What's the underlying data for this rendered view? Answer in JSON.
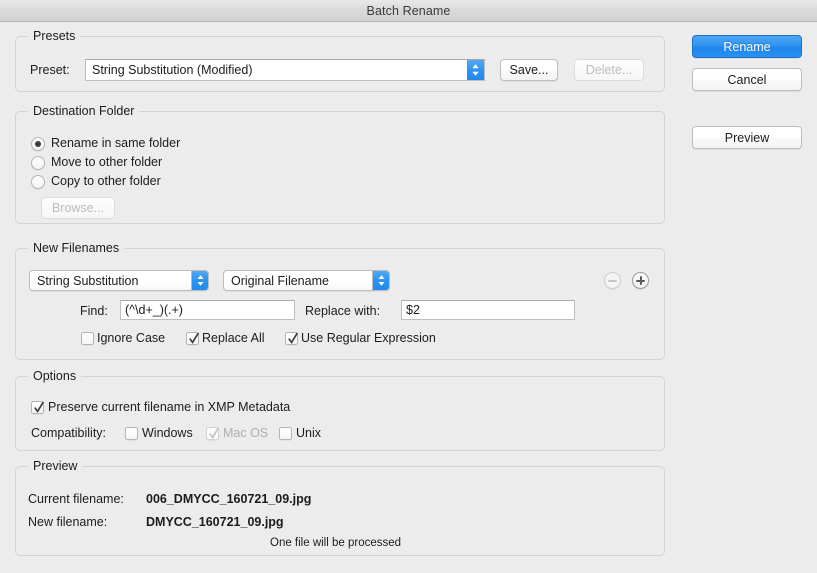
{
  "window": {
    "title": "Batch Rename"
  },
  "presets": {
    "group_label": "Presets",
    "preset_label": "Preset:",
    "preset_value": "String Substitution (Modified)",
    "save_button": "Save...",
    "delete_button": "Delete..."
  },
  "destination": {
    "group_label": "Destination Folder",
    "options": [
      {
        "label": "Rename in same folder",
        "selected": true
      },
      {
        "label": "Move to other folder",
        "selected": false
      },
      {
        "label": "Copy to other folder",
        "selected": false
      }
    ],
    "browse_button": "Browse..."
  },
  "new_filenames": {
    "group_label": "New Filenames",
    "rule_type": "String Substitution",
    "rule_source": "Original Filename",
    "find_label": "Find:",
    "find_value": "(^\\d+_)(.+)",
    "replace_label": "Replace with:",
    "replace_value": "$2",
    "checkboxes": [
      {
        "label": "Ignore Case",
        "checked": false
      },
      {
        "label": "Replace All",
        "checked": true
      },
      {
        "label": "Use Regular Expression",
        "checked": true
      }
    ],
    "remove_rule_button": "−",
    "add_rule_button": "+"
  },
  "options": {
    "group_label": "Options",
    "preserve_label": "Preserve current filename in XMP Metadata",
    "preserve_checked": true,
    "compatibility_label": "Compatibility:",
    "compatibility": [
      {
        "label": "Windows",
        "checked": false,
        "disabled": false
      },
      {
        "label": "Mac OS",
        "checked": true,
        "disabled": true
      },
      {
        "label": "Unix",
        "checked": false,
        "disabled": false
      }
    ]
  },
  "preview": {
    "group_label": "Preview",
    "current_label": "Current filename:",
    "current_value": "006_DMYCC_160721_09.jpg",
    "new_label": "New filename:",
    "new_value": "DMYCC_160721_09.jpg",
    "status": "One file will be processed"
  },
  "actions": {
    "rename_button": "Rename",
    "cancel_button": "Cancel",
    "preview_button": "Preview"
  },
  "colors": {
    "accent": "#2e92ee",
    "window_bg": "#ececec",
    "group_border": "#d3d3d3",
    "text": "#1c1c1c",
    "disabled_text": "#b0b0b0"
  }
}
